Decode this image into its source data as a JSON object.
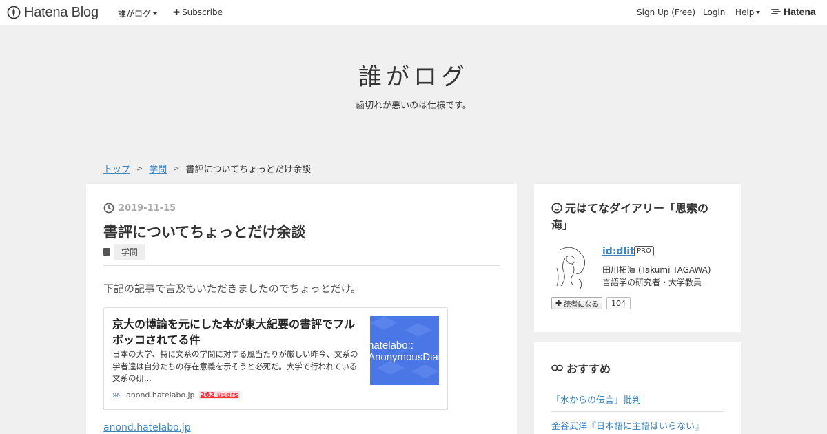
{
  "global_header": {
    "logo_text": "Hatena Blog",
    "blog_menu_label": "誰がログ",
    "subscribe_label": "Subscribe",
    "signup_label": "Sign Up (Free)",
    "login_label": "Login",
    "help_label": "Help",
    "hatena_label": "Hatena"
  },
  "blog": {
    "title": "誰がログ",
    "description": "歯切れが悪いのは仕様です。"
  },
  "breadcrumb": {
    "home": "トップ",
    "sep": ">",
    "category": "学問",
    "current": "書評についてちょっとだけ余談"
  },
  "entry": {
    "date": "2019-11-15",
    "title": "書評についてちょっとだけ余談",
    "category": "学問",
    "lead": "下記の記事で言及もいただきましたのでちょっとだけ。",
    "embed": {
      "title": "京大の博論を元にした本が東大紀要の書評でフルボッコされてる件",
      "body": "日本の大学、特に文系の学問に対する風当たりが厳しい昨今、文系の学者達は自分たちの存在意義を示そうと必死だ。大学で行われている文系の研...",
      "thumb_line1": "hatelabo::",
      "thumb_line2": "AnonymousDiary",
      "site": "anond.hatelabo.jp",
      "users": "262 users"
    },
    "source_link": "anond.hatelabo.jp"
  },
  "sidebar": {
    "profile_heading": "元はてなダイアリー「思索の海」",
    "user_id": "id:dlit",
    "pro_badge": "PRO",
    "user_name": "田川拓海 (Takumi TAGAWA)",
    "user_bio": "言語学の研究者・大学教員",
    "reader_button": "読者になる",
    "reader_count": "104",
    "recommend_heading": "おすすめ",
    "recommend_items": [
      "「水からの伝言」批判",
      "金谷武洋『日本語に主語はいらない』"
    ]
  },
  "colors": {
    "link": "#3c85c0",
    "background": "#f0f0f0",
    "bookmark_red": "#f3303a",
    "thumb_blue": "#4b77e6"
  }
}
